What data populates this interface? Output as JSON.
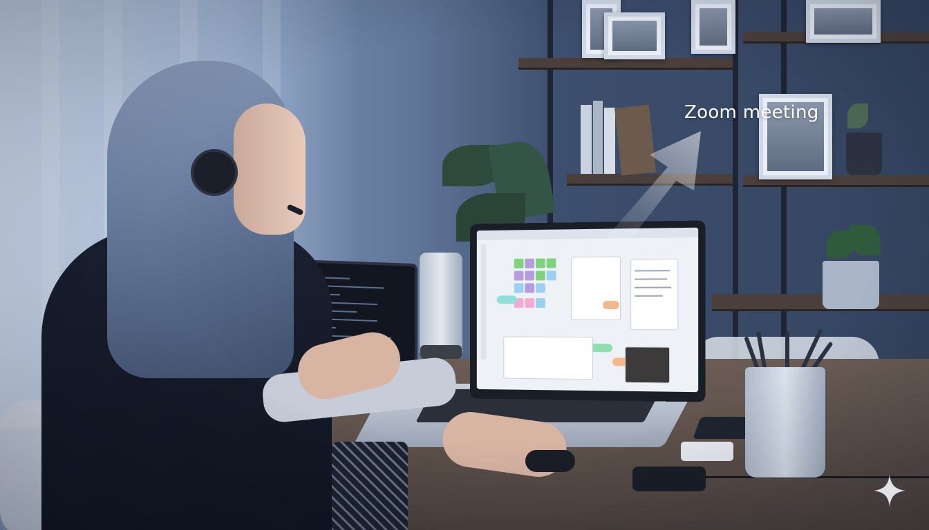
{
  "annotation": {
    "label": "Zoom meeting"
  },
  "icons": {
    "corner_mark": "sparkle-icon"
  },
  "colors": {
    "label_text": "#ffffff",
    "arrow_fill": "#ffffff"
  }
}
